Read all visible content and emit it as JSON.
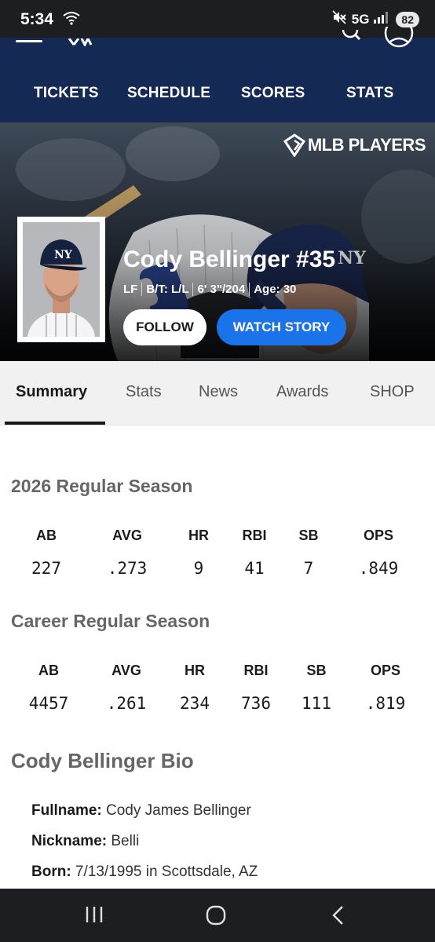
{
  "status_bar": {
    "time": "5:34",
    "network": "5G",
    "battery": "82"
  },
  "header": {
    "nav": [
      "TICKETS",
      "SCHEDULE",
      "SCORES",
      "STATS"
    ]
  },
  "hero": {
    "partner_logo": "MLB PLAYERS",
    "player_name": "Cody Bellinger #35",
    "position": "LF",
    "bats_throws": "B/T: L/L",
    "height_weight": "6' 3\"/204",
    "age": "Age: 30",
    "follow_label": "FOLLOW",
    "watch_label": "WATCH STORY"
  },
  "tabs": [
    {
      "label": "Summary",
      "active": true
    },
    {
      "label": "Stats",
      "active": false
    },
    {
      "label": "News",
      "active": false
    },
    {
      "label": "Awards",
      "active": false
    },
    {
      "label": "SHOP",
      "active": false
    }
  ],
  "season": {
    "title": "2026 Regular Season",
    "headers": [
      "AB",
      "AVG",
      "HR",
      "RBI",
      "SB",
      "OPS"
    ],
    "values": [
      "227",
      ".273",
      "9",
      "41",
      "7",
      ".849"
    ]
  },
  "career": {
    "title": "Career Regular Season",
    "headers": [
      "AB",
      "AVG",
      "HR",
      "RBI",
      "SB",
      "OPS"
    ],
    "values": [
      "4457",
      ".261",
      "234",
      "736",
      "111",
      ".819"
    ]
  },
  "bio": {
    "title": "Cody Bellinger Bio",
    "rows": [
      {
        "label": "Fullname:",
        "value": " Cody James Bellinger"
      },
      {
        "label": "Nickname:",
        "value": " Belli"
      },
      {
        "label": "Born:",
        "value": " 7/13/1995 in Scottsdale, AZ"
      }
    ]
  },
  "colors": {
    "header_bg": "#142953",
    "accent_blue": "#1a73e8",
    "system_bar": "#1d1e22"
  },
  "icons": [
    "wifi-icon",
    "mute-icon",
    "signal-icon",
    "menu-icon",
    "search-icon",
    "account-icon",
    "players-shield-icon",
    "recents-icon",
    "home-icon",
    "back-icon"
  ]
}
